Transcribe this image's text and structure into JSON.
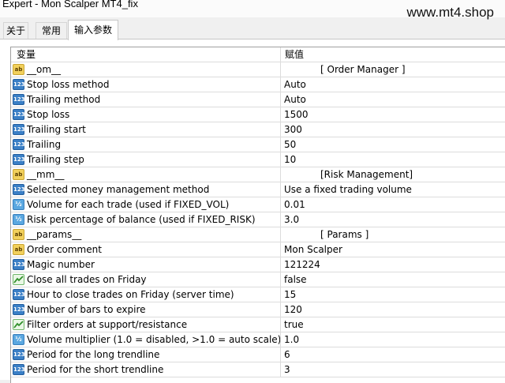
{
  "window": {
    "title": "Expert - Mon Scalper MT4_fix",
    "watermark": "www.mt4.shop"
  },
  "tabs": [
    {
      "label": "关于"
    },
    {
      "label": "常用"
    },
    {
      "label": "输入参数",
      "active": true
    }
  ],
  "table": {
    "columns": {
      "name": "变量",
      "value": "赋值"
    },
    "rows": [
      {
        "icon": "string-icon",
        "name": "__om__",
        "value": "[ Order Manager ]",
        "section": true
      },
      {
        "icon": "enum-icon",
        "name": "Stop loss method",
        "value": "Auto"
      },
      {
        "icon": "enum-icon",
        "name": "Trailing method",
        "value": "Auto"
      },
      {
        "icon": "integer-icon",
        "name": "Stop loss",
        "value": "1500"
      },
      {
        "icon": "integer-icon",
        "name": "Trailing start",
        "value": "300"
      },
      {
        "icon": "integer-icon",
        "name": "Trailing",
        "value": "50"
      },
      {
        "icon": "integer-icon",
        "name": "Trailing step",
        "value": "10"
      },
      {
        "icon": "string-icon",
        "name": "__mm__",
        "value": "[Risk Management]",
        "section": true
      },
      {
        "icon": "enum-icon",
        "name": "Selected money management method",
        "value": "Use a fixed trading volume"
      },
      {
        "icon": "double-icon",
        "name": "Volume for each trade (used if FIXED_VOL)",
        "value": "0.01"
      },
      {
        "icon": "double-icon",
        "name": "Risk percentage of balance (used if FIXED_RISK)",
        "value": "3.0"
      },
      {
        "icon": "string-icon",
        "name": "__params__",
        "value": "[ Params ]",
        "section": true
      },
      {
        "icon": "string-icon",
        "name": "Order comment",
        "value": "Mon Scalper"
      },
      {
        "icon": "integer-icon",
        "name": "Magic number",
        "value": "121224"
      },
      {
        "icon": "bool-icon",
        "name": "Close all trades on Friday",
        "value": "false"
      },
      {
        "icon": "integer-icon",
        "name": "Hour to close trades on Friday (server time)",
        "value": "15"
      },
      {
        "icon": "integer-icon",
        "name": "Number of bars to expire",
        "value": "120"
      },
      {
        "icon": "bool-icon",
        "name": "Filter orders at support/resistance",
        "value": "true"
      },
      {
        "icon": "double-icon",
        "name": "Volume multiplier (1.0 = disabled, >1.0 = auto scale)",
        "value": "1.0"
      },
      {
        "icon": "integer-icon",
        "name": "Period for the long trendline",
        "value": "6"
      },
      {
        "icon": "integer-icon",
        "name": "Period for the short trendline",
        "value": "3"
      }
    ]
  }
}
